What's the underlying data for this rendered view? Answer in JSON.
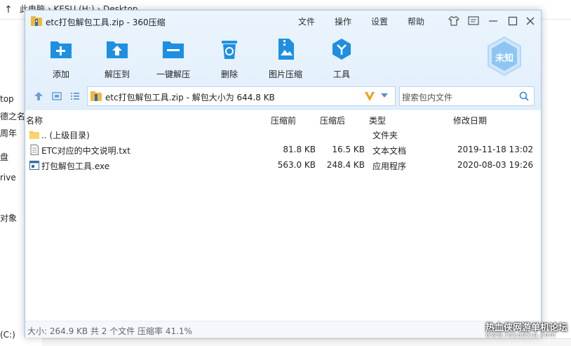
{
  "background": {
    "path": "此电脑 › KESU (H:) › Desktop",
    "side": [
      "top",
      "德之名",
      "周年",
      "盘",
      "rive",
      "对象"
    ],
    "drive": "(C:)"
  },
  "window": {
    "title": "etc打包解包工具.zip - 360压缩",
    "menu": [
      "文件",
      "操作",
      "设置",
      "帮助"
    ],
    "toolbar": [
      {
        "label": "添加",
        "icon": "add-icon"
      },
      {
        "label": "解压到",
        "icon": "extract-to-icon"
      },
      {
        "label": "一键解压",
        "icon": "quick-extract-icon"
      },
      {
        "label": "删除",
        "icon": "delete-icon"
      },
      {
        "label": "图片压缩",
        "icon": "image-compress-icon"
      },
      {
        "label": "工具",
        "icon": "tools-icon"
      }
    ],
    "badge": "未知",
    "path": "etc打包解包工具.zip - 解包大小为 644.8 KB",
    "search_placeholder": "搜索包内文件",
    "columns": [
      "名称",
      "压缩前",
      "压缩后",
      "类型",
      "修改日期"
    ],
    "rows": [
      {
        "name": ".. (上级目录)",
        "before": "",
        "after": "",
        "type": "文件夹",
        "date": "",
        "icon": "folder-icon"
      },
      {
        "name": "ETC对应的中文说明.txt",
        "before": "81.8 KB",
        "after": "16.5 KB",
        "type": "文本文档",
        "date": "2019-11-18 13:02",
        "icon": "text-file-icon"
      },
      {
        "name": "打包解包工具.exe",
        "before": "563.0 KB",
        "after": "248.4 KB",
        "type": "应用程序",
        "date": "2020-08-03 19:26",
        "icon": "exe-file-icon"
      }
    ],
    "status": "大小: 264.9 KB 共 2 个文件 压缩率 41.1%"
  },
  "watermark": {
    "line1": "热血侠网游单机论坛",
    "line2": "www.rexuexia.com"
  },
  "colors": {
    "accent": "#1e8fe1",
    "title_bg": "#eaf4fd"
  }
}
